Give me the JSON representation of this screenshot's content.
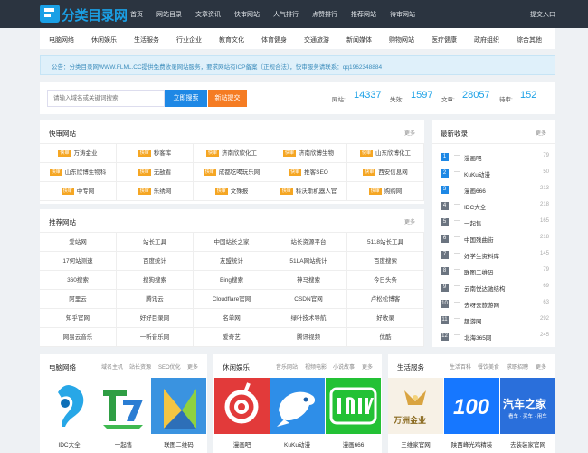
{
  "header": {
    "logo_text": "分类目录网",
    "nav": [
      "首页",
      "网站目录",
      "文章资讯",
      "快审网站",
      "人气排行",
      "点赞排行",
      "推荐网站",
      "待审网站"
    ],
    "submit_link": "提交入口"
  },
  "subnav": [
    "电脑网络",
    "休闲娱乐",
    "生活服务",
    "行业企业",
    "教育文化",
    "体育健身",
    "交通旅游",
    "新闻媒体",
    "购物网站",
    "医疗健康",
    "政府组织",
    "综合其他"
  ],
  "notice": "公告：分类目录网WWW.FLML.CC提供免费收录网站服务，要求网站有ICP备案（正规合法），快审服务请联系：qq1962348884",
  "search": {
    "placeholder": "请输入域名或关键词搜索!",
    "search_button": "立即搜索",
    "submit_button": "新站提交"
  },
  "stats": [
    {
      "label": "网站:",
      "value": "14337"
    },
    {
      "label": "失效:",
      "value": "1597"
    },
    {
      "label": "文章:",
      "value": "28057"
    },
    {
      "label": "待审:",
      "value": "152"
    }
  ],
  "fast_review": {
    "title": "快审网站",
    "more": "更多",
    "tag": "快审",
    "items": [
      "万涛金业",
      "秒客库",
      "济南欣欣化工",
      "济南欣博生物",
      "山东欣博化工",
      "山东欣博生物科",
      "无敌看",
      "成都吃喝玩乐网",
      "推客SEO",
      "西安信息网",
      "中专网",
      "乐绣网",
      "文殊报",
      "科沃斯机器人官",
      "购购网"
    ]
  },
  "recommended": {
    "title": "推荐网站",
    "more": "更多",
    "items": [
      "爱站网",
      "站长工具",
      "中国站长之家",
      "站长资源平台",
      "5118站长工具",
      "17何站测速",
      "百度统计",
      "友盟统计",
      "51LA网站统计",
      "百度搜索",
      "360搜索",
      "搜狗搜索",
      "Bing搜索",
      "神马搜索",
      "今日头条",
      "阿里云",
      "腾讯云",
      "Cloudflare官网",
      "CSDN官网",
      "卢松松博客",
      "知乎官网",
      "好好目录网",
      "名单网",
      "绿叶技术导航",
      "好收录",
      "网易云音乐",
      "一听音乐网",
      "爱奇艺",
      "腾讯视频",
      "优酷"
    ]
  },
  "latest": {
    "title": "最新收录",
    "more": "更多",
    "items": [
      {
        "rank": "1",
        "name": "漫画吧",
        "count": "79"
      },
      {
        "rank": "2",
        "name": "KuKu动漫",
        "count": "50"
      },
      {
        "rank": "3",
        "name": "漫画666",
        "count": "213"
      },
      {
        "rank": "4",
        "name": "IDC大全",
        "count": "218"
      },
      {
        "rank": "5",
        "name": "一起售",
        "count": "165"
      },
      {
        "rank": "6",
        "name": "中国残曲街",
        "count": "218"
      },
      {
        "rank": "7",
        "name": "好学生资料库",
        "count": "145"
      },
      {
        "rank": "8",
        "name": "联图二维码",
        "count": "79"
      },
      {
        "rank": "9",
        "name": "云南悦达驰结构",
        "count": "69"
      },
      {
        "rank": "10",
        "name": "去呀去旅游网",
        "count": "63"
      },
      {
        "rank": "11",
        "name": "趣游网",
        "count": "292"
      },
      {
        "rank": "12",
        "name": "北海365网",
        "count": "245"
      }
    ]
  },
  "category_cards": [
    {
      "title": "电脑网络",
      "tabs": [
        "域名主机",
        "站长资源",
        "SEO优化",
        "更多"
      ],
      "apps": [
        "IDC大全",
        "一起售",
        "联图二维码"
      ]
    },
    {
      "title": "休闲娱乐",
      "tabs": [
        "音乐网站",
        "视频电影",
        "小说故事",
        "更多"
      ],
      "apps": [
        "漫画吧",
        "KuKu动漫",
        "漫画666"
      ]
    },
    {
      "title": "生活服务",
      "tabs": [
        "生活百科",
        "餐饮美食",
        "求职招聘",
        "更多"
      ],
      "apps": [
        "三维家官网",
        "陕西峰光鸡精装",
        "去装装家官网"
      ]
    }
  ],
  "app_logo_text": [
    "万洲金业",
    "100",
    "汽车之家",
    "看车 · 买车 · 用车"
  ],
  "colors": {
    "accent": "#1aa0e6",
    "header_bg": "#2b3440",
    "search_btn": "#1e88e5",
    "submit_btn": "#f57c23",
    "tag": "#f5a623"
  }
}
